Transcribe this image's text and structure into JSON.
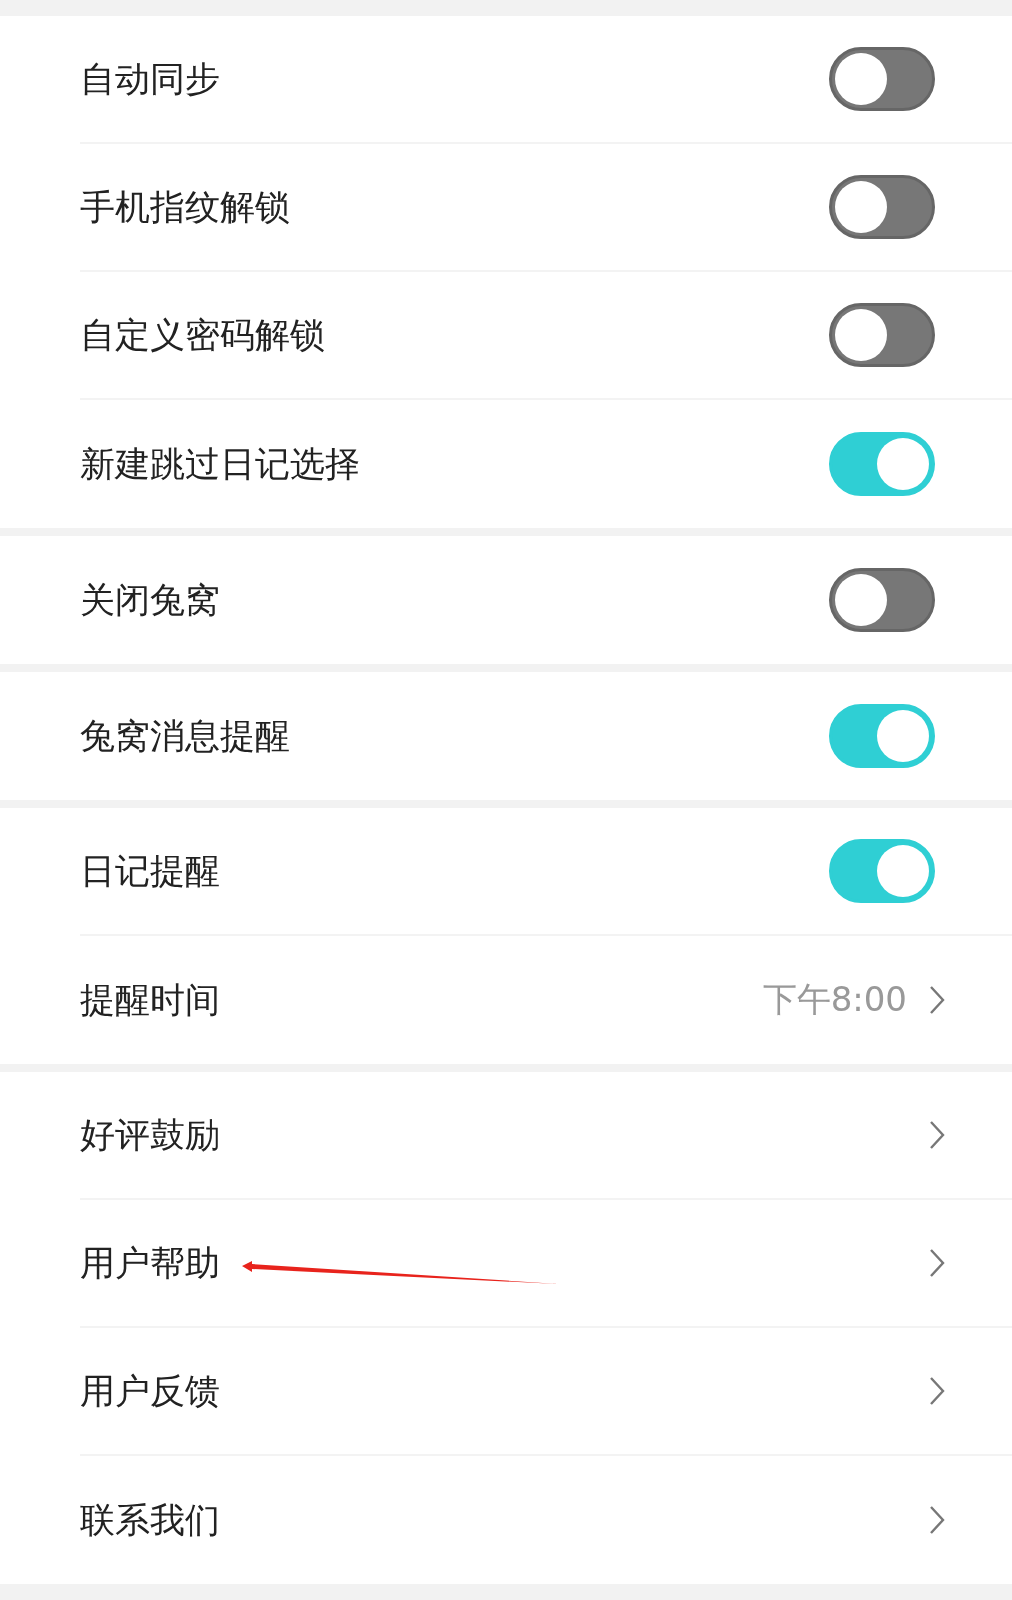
{
  "groups": [
    {
      "items": [
        {
          "label": "自动同步",
          "kind": "toggle",
          "on": false
        },
        {
          "label": "手机指纹解锁",
          "kind": "toggle",
          "on": false
        },
        {
          "label": "自定义密码解锁",
          "kind": "toggle",
          "on": false
        },
        {
          "label": "新建跳过日记选择",
          "kind": "toggle",
          "on": true
        }
      ]
    },
    {
      "items": [
        {
          "label": "关闭兔窝",
          "kind": "toggle",
          "on": false
        }
      ]
    },
    {
      "items": [
        {
          "label": "兔窝消息提醒",
          "kind": "toggle",
          "on": true
        }
      ]
    },
    {
      "items": [
        {
          "label": "日记提醒",
          "kind": "toggle",
          "on": true
        },
        {
          "label": "提醒时间",
          "kind": "link",
          "value": "下午8:00"
        }
      ]
    },
    {
      "items": [
        {
          "label": "好评鼓励",
          "kind": "link"
        },
        {
          "label": "用户帮助",
          "kind": "link",
          "annotated": true
        },
        {
          "label": "用户反馈",
          "kind": "link"
        },
        {
          "label": "联系我们",
          "kind": "link"
        }
      ]
    }
  ]
}
